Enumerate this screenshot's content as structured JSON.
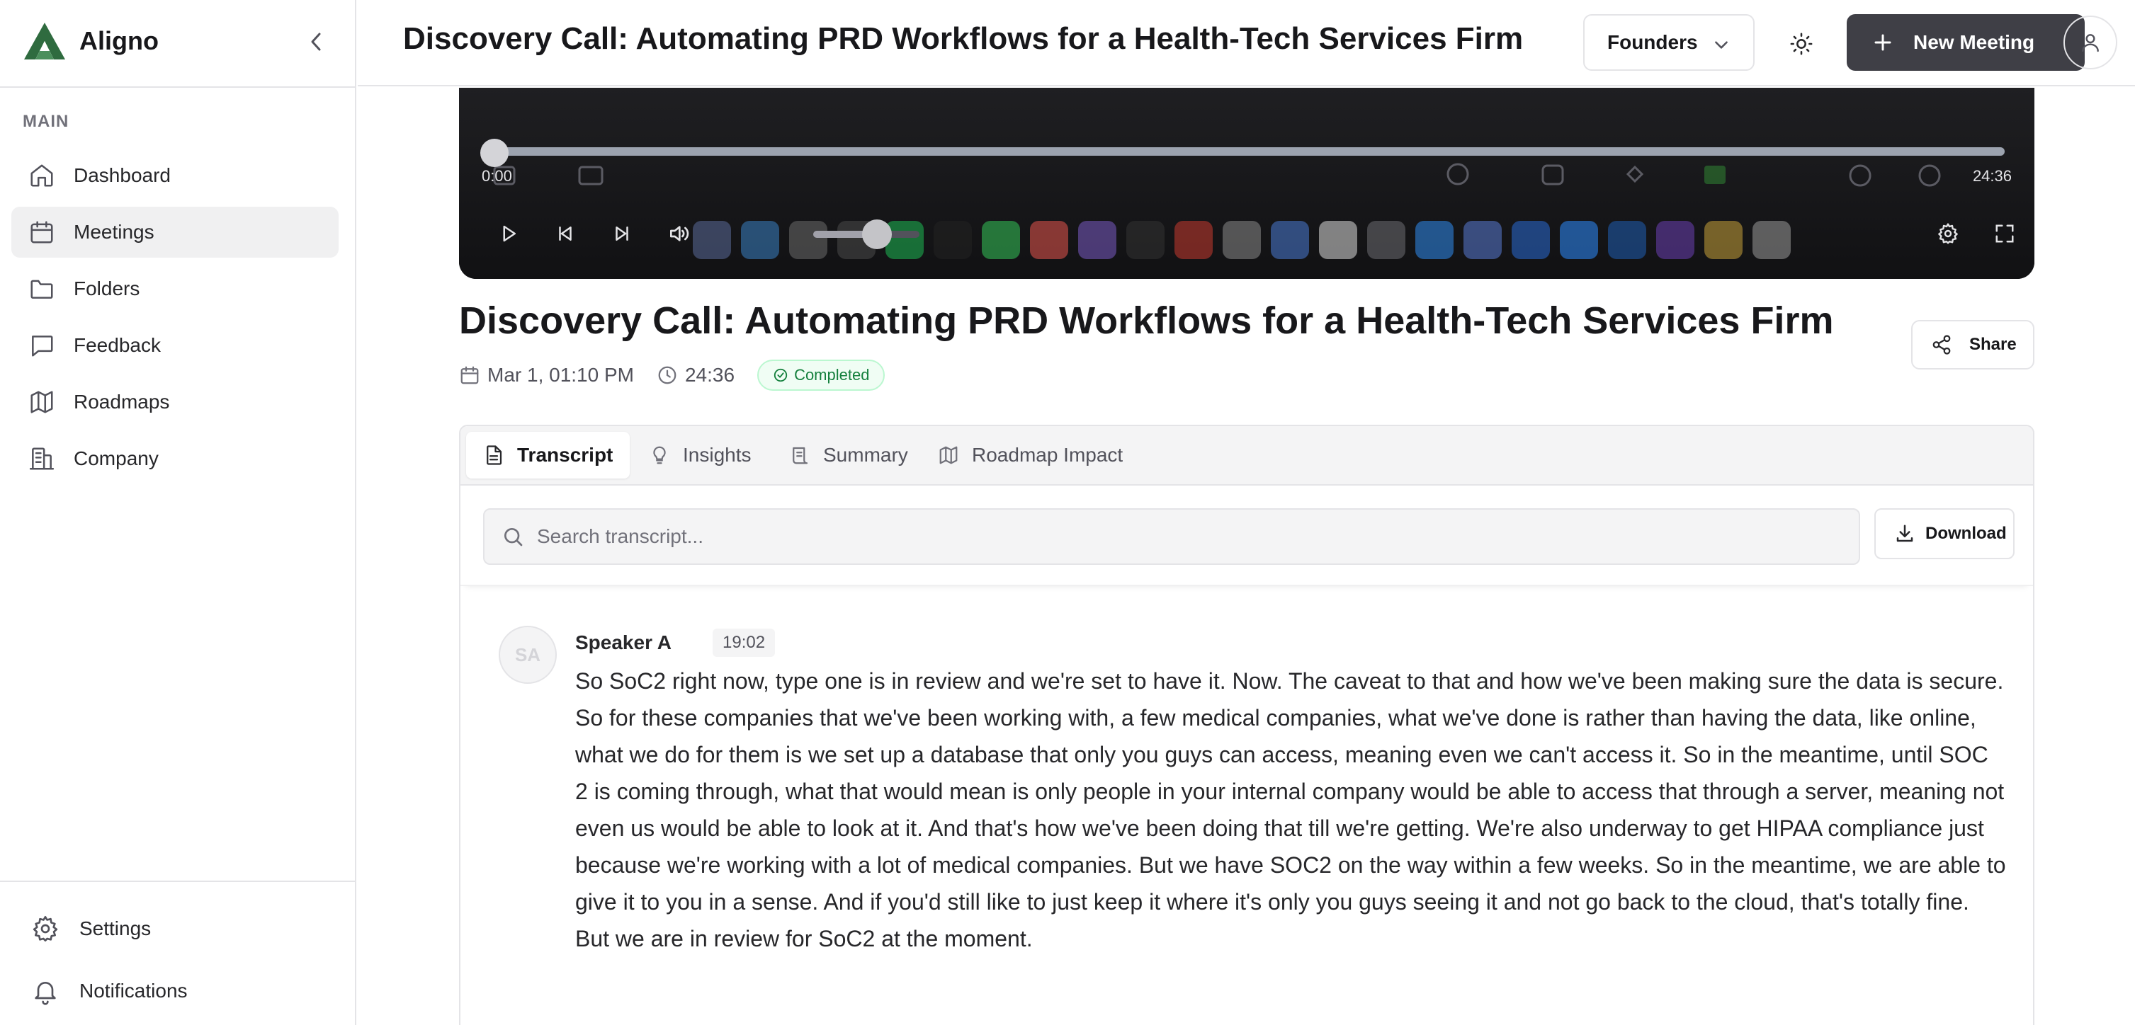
{
  "brand": {
    "name": "Aligno"
  },
  "sidebar": {
    "section_label": "MAIN",
    "items": [
      {
        "label": "Dashboard",
        "icon": "home-icon"
      },
      {
        "label": "Meetings",
        "icon": "calendar-icon",
        "active": true
      },
      {
        "label": "Folders",
        "icon": "folder-icon"
      },
      {
        "label": "Feedback",
        "icon": "message-icon"
      },
      {
        "label": "Roadmaps",
        "icon": "map-icon"
      },
      {
        "label": "Company",
        "icon": "building-icon"
      }
    ],
    "bottom": [
      {
        "label": "Settings",
        "icon": "gear-icon"
      },
      {
        "label": "Notifications",
        "icon": "bell-icon"
      }
    ]
  },
  "topbar": {
    "title": "Discovery Call: Automating PRD Workflows for a Health-Tech Services Firm",
    "workspace": "Founders",
    "new_meeting_label": "New Meeting"
  },
  "player": {
    "current_time": "0:00",
    "duration": "24:36",
    "progress": 0.0,
    "volume": 0.6
  },
  "meeting": {
    "title": "Discovery Call: Automating PRD Workflows for a Health-Tech Services Firm",
    "date": "Mar 1, 01:10 PM",
    "duration": "24:36",
    "status": "Completed",
    "share_label": "Share"
  },
  "tabs": [
    {
      "label": "Transcript",
      "icon": "document-icon",
      "active": true
    },
    {
      "label": "Insights",
      "icon": "lightbulb-icon"
    },
    {
      "label": "Summary",
      "icon": "scroll-icon"
    },
    {
      "label": "Roadmap Impact",
      "icon": "map-icon"
    }
  ],
  "transcript": {
    "search_placeholder": "Search transcript...",
    "download_label": "Download",
    "entries": [
      {
        "initials": "SA",
        "speaker": "Speaker A",
        "timestamp": "19:02",
        "text": "So SoC2 right now, type one is in review and we're set to have it. Now. The caveat to that and how we've been making sure the data is secure. So for these companies that we've been working with, a few medical companies, what we've done is rather than having the data, like online, what we do for them is we set up a database that only you guys can access, meaning even we can't access it. So in the meantime, until SOC 2 is coming through, what that would mean is only people in your internal company would be able to access that through a server, meaning not even us would be able to look at it. And that's how we've been doing that till we're getting. We're also underway to get HIPAA compliance just because we're working with a lot of medical companies. But we have SOC2 on the way within a few weeks. So in the meantime, we are able to give it to you in a sense. And if you'd still like to just keep it where it's only you guys seeing it and not go back to the cloud, that's totally fine. But we are in review for SoC2 at the moment."
      }
    ]
  },
  "colors": {
    "accent": "#3f3f46",
    "brand": "#2f6b3f",
    "status": "#15803d"
  }
}
